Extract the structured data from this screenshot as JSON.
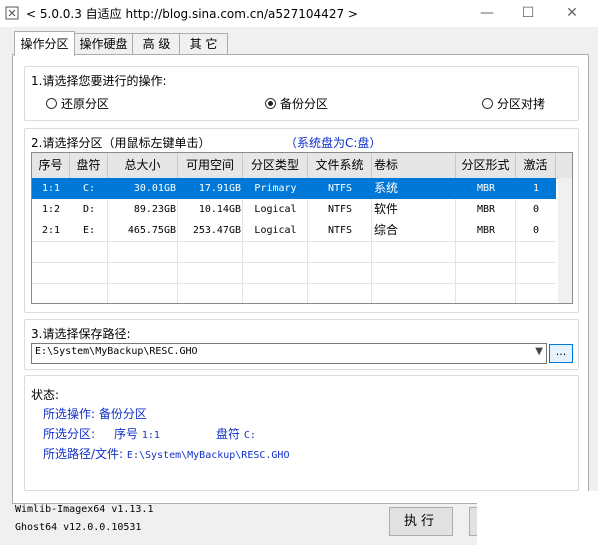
{
  "window": {
    "title": "< 5.0.0.3 自适应 http://blog.sina.com.cn/a527104427 >",
    "min_glyph": "—",
    "max_glyph": "☐",
    "close_glyph": "✕"
  },
  "tabs": [
    {
      "label": "操作分区",
      "active": true
    },
    {
      "label": "操作硬盘",
      "active": false
    },
    {
      "label": "高 级",
      "active": false
    },
    {
      "label": "其 它",
      "active": false
    }
  ],
  "operation": {
    "prompt": "1.请选择您要进行的操作:",
    "options": [
      {
        "label": "还原分区",
        "selected": false
      },
      {
        "label": "备份分区",
        "selected": true
      },
      {
        "label": "分区对拷",
        "selected": false
      }
    ]
  },
  "partition": {
    "prompt": "2.请选择分区（用鼠标左键单击）",
    "system_note": "（系统盘为C:盘）",
    "columns": [
      "序号",
      "盘符",
      "总大小",
      "可用空间",
      "分区类型",
      "文件系统",
      "卷标",
      "分区形式",
      "激活"
    ],
    "rows": [
      {
        "no": "1:1",
        "drive": "C:",
        "total": "30.01GB",
        "free": "17.91GB",
        "type": "Primary",
        "fs": "NTFS",
        "label": "系统",
        "form": "MBR",
        "active": "1",
        "selected": true
      },
      {
        "no": "1:2",
        "drive": "D:",
        "total": "89.23GB",
        "free": "10.14GB",
        "type": "Logical",
        "fs": "NTFS",
        "label": "软件",
        "form": "MBR",
        "active": "0",
        "selected": false
      },
      {
        "no": "2:1",
        "drive": "E:",
        "total": "465.75GB",
        "free": "253.47GB",
        "type": "Logical",
        "fs": "NTFS",
        "label": "综合",
        "form": "MBR",
        "active": "0",
        "selected": false
      }
    ]
  },
  "save_path": {
    "prompt": "3.请选择保存路径:",
    "value": "E:\\System\\MyBackup\\RESC.GHO",
    "browse_label": "..."
  },
  "status": {
    "title": "状态:",
    "op_label": "所选操作:",
    "op_value": "备份分区",
    "part_label": "所选分区:",
    "part_no_label": "序号",
    "part_no_value": "1:1",
    "part_drive_label": "盘符",
    "part_drive_value": "C:",
    "path_label": "所选路径/文件:",
    "path_value": "E:\\System\\MyBackup\\RESC.GHO"
  },
  "footer": {
    "wimlib_version": "Wimlib-Imagex64 v1.13.1",
    "ghost_version": "Ghost64 v12.0.0.10531",
    "execute_label": "执行"
  },
  "colors": {
    "selection": "#0078d7",
    "status_text": "#1030c8",
    "window_bg": "#f0f0f0"
  }
}
